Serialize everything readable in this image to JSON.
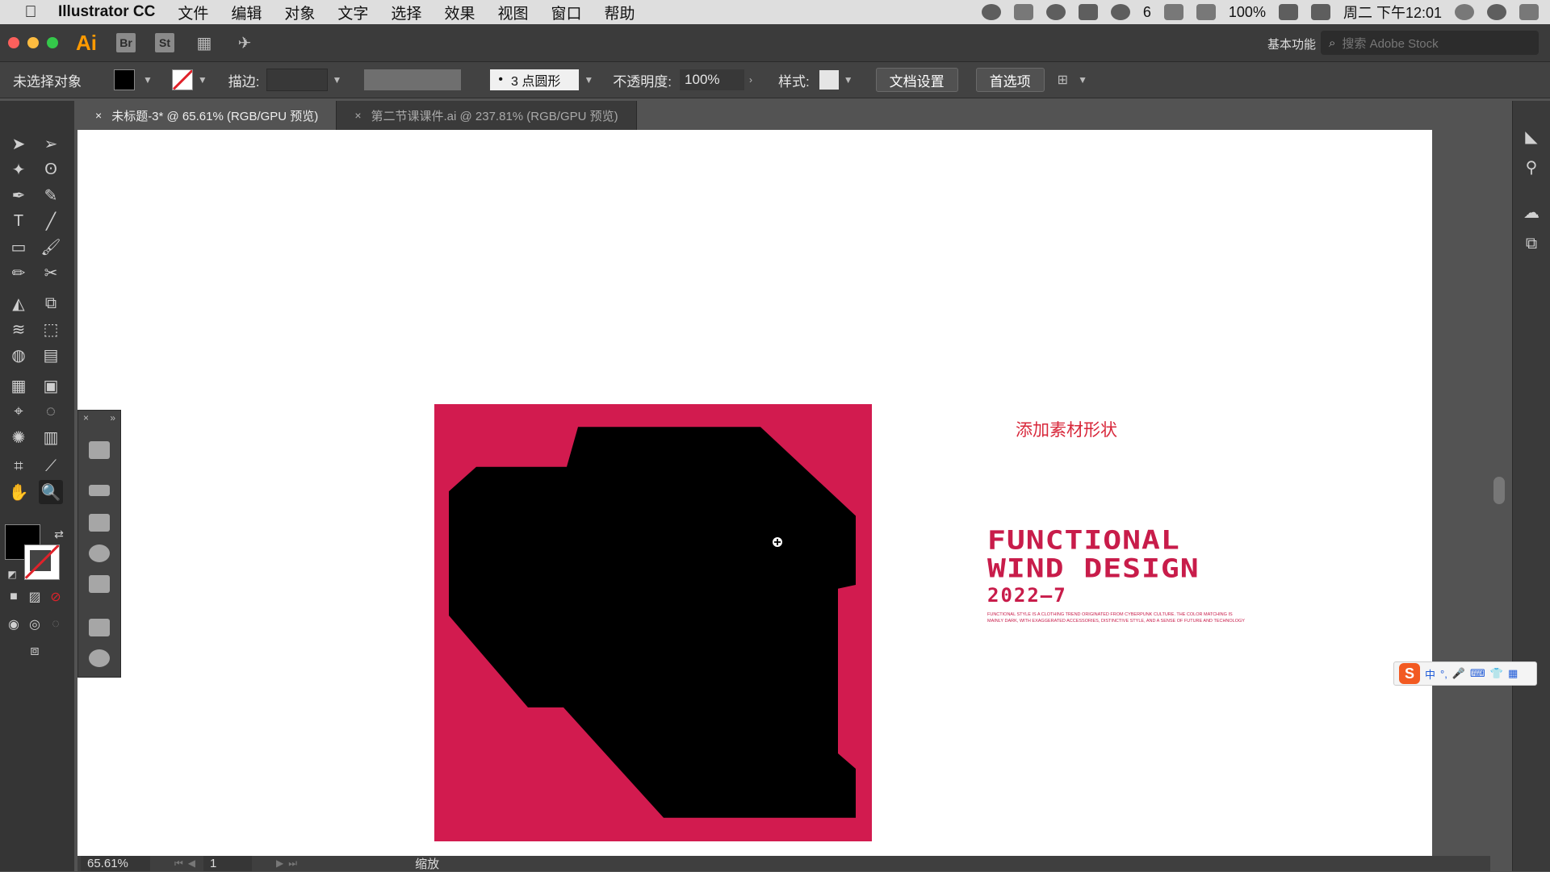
{
  "menubar": {
    "apple_icon": "apple-icon",
    "app_name": "Illustrator CC",
    "items": [
      "文件",
      "编辑",
      "对象",
      "文字",
      "选择",
      "效果",
      "视图",
      "窗口",
      "帮助"
    ],
    "status": {
      "wechat_count": "6",
      "battery": "100%",
      "clock": "周二 下午12:01"
    }
  },
  "appbar": {
    "logo": "Ai",
    "bridge": "Br",
    "stock": "St",
    "workspace": "基本功能",
    "search_placeholder": "搜索 Adobe Stock"
  },
  "controlbar": {
    "selection_status": "未选择对象",
    "stroke_label": "描边:",
    "brush_label": "3 点圆形",
    "opacity_label": "不透明度:",
    "opacity_value": "100%",
    "style_label": "样式:",
    "doc_setup": "文档设置",
    "preferences": "首选项"
  },
  "tabs": [
    {
      "label": "未标题-3* @ 65.61% (RGB/GPU 预览)",
      "active": true
    },
    {
      "label": "第二节课课件.ai @ 237.81% (RGB/GPU 预览)",
      "active": false
    }
  ],
  "canvas": {
    "caption": "添加素材形状",
    "title_line1": "FUNCTIONAL",
    "title_line2": "WIND DESIGN",
    "year": "2022—7",
    "small_text": "FUNCTIONAL STYLE IS A CLOTHING TREND ORIGINATED FROM CYBERPUNK CULTURE. THE COLOR MATCHING IS MAINLY DARK, WITH EXAGGERATED ACCESSORIES, DISTINCTIVE STYLE, AND A SENSE OF FUTURE AND TECHNOLOGY",
    "artboard_color": "#d21b4f",
    "shape_color": "#000000"
  },
  "statusbar": {
    "zoom": "65.61%",
    "page": "1",
    "tool_name": "缩放"
  },
  "ime": {
    "items": [
      "中",
      "°,",
      "🎤",
      "⌨",
      "👕",
      "▦"
    ]
  }
}
